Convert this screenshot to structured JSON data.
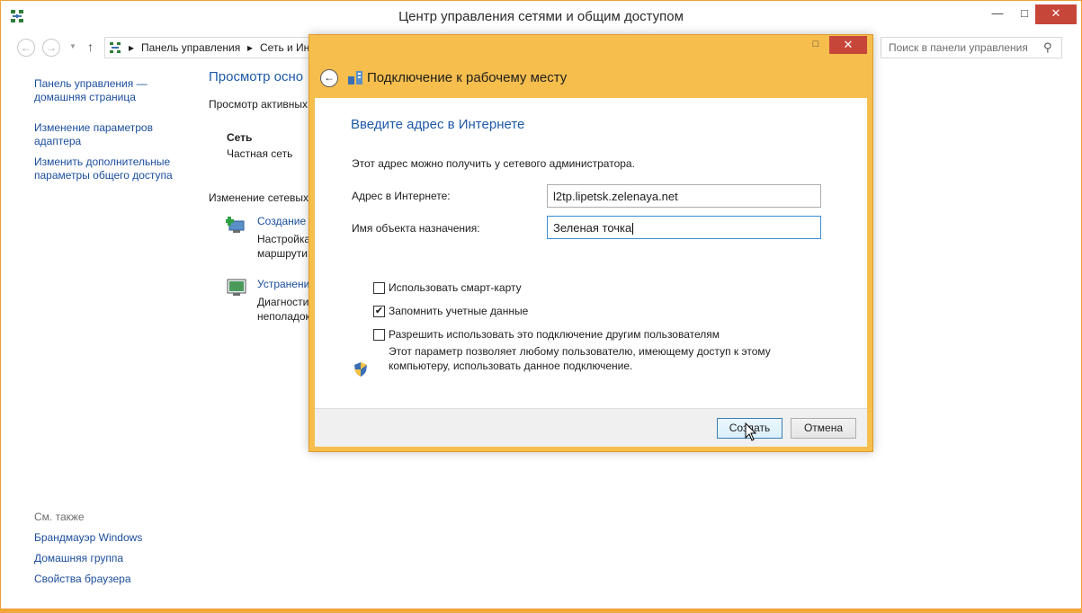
{
  "window": {
    "title": "Центр управления сетями и общим доступом",
    "min": "—",
    "max": "□",
    "close": "✕"
  },
  "nav": {
    "back": "←",
    "forward": "→",
    "dropdown": "▼",
    "up": "↑",
    "breadcrumb": [
      "Панель управления",
      "Сеть и Инт"
    ],
    "separator": "▸",
    "search_placeholder": "Поиск в панели управления",
    "search_glyph": "⚲"
  },
  "sidebar": {
    "links": [
      "Панель управления —\nдомашняя страница",
      "Изменение параметров\nадаптера",
      "Изменить дополнительные\nпараметры общего доступа"
    ],
    "see_also_label": "См. также",
    "see_also": [
      "Брандмауэр Windows",
      "Домашняя группа",
      "Свойства браузера"
    ]
  },
  "content": {
    "title": "Просмотр осно",
    "active_networks": "Просмотр активных",
    "network_name": "Сеть",
    "network_type": "Частная сеть",
    "change_settings": "Изменение сетевых",
    "task1_link": "Создание и",
    "task1_desc": "Настройка\nмаршрути",
    "task2_link": "Устранени",
    "task2_desc": "Диагности\nнеполадок"
  },
  "dialog": {
    "min": "—",
    "max": "□",
    "close": "✕",
    "back": "←",
    "title": "Подключение к рабочему месту",
    "heading": "Введите адрес в Интернете",
    "intro": "Этот адрес можно получить у сетевого администратора.",
    "address_label": "Адрес в Интернете:",
    "address_value": "l2tp.lipetsk.zelenaya.net",
    "dest_label": "Имя объекта назначения:",
    "dest_value": "Зеленая точка",
    "checkboxes": [
      {
        "label": "Использовать смарт-карту",
        "checked": false,
        "mark": ""
      },
      {
        "label": "Запомнить учетные данные",
        "checked": true,
        "mark": "✔"
      },
      {
        "label": "Разрешить использовать это подключение другим пользователям",
        "checked": false,
        "mark": ""
      }
    ],
    "note": "Этот параметр позволяет любому пользователю, имеющему доступ к этому компьютеру, использовать данное подключение.",
    "create_button": "Создать",
    "cancel_button": "Отмена"
  }
}
